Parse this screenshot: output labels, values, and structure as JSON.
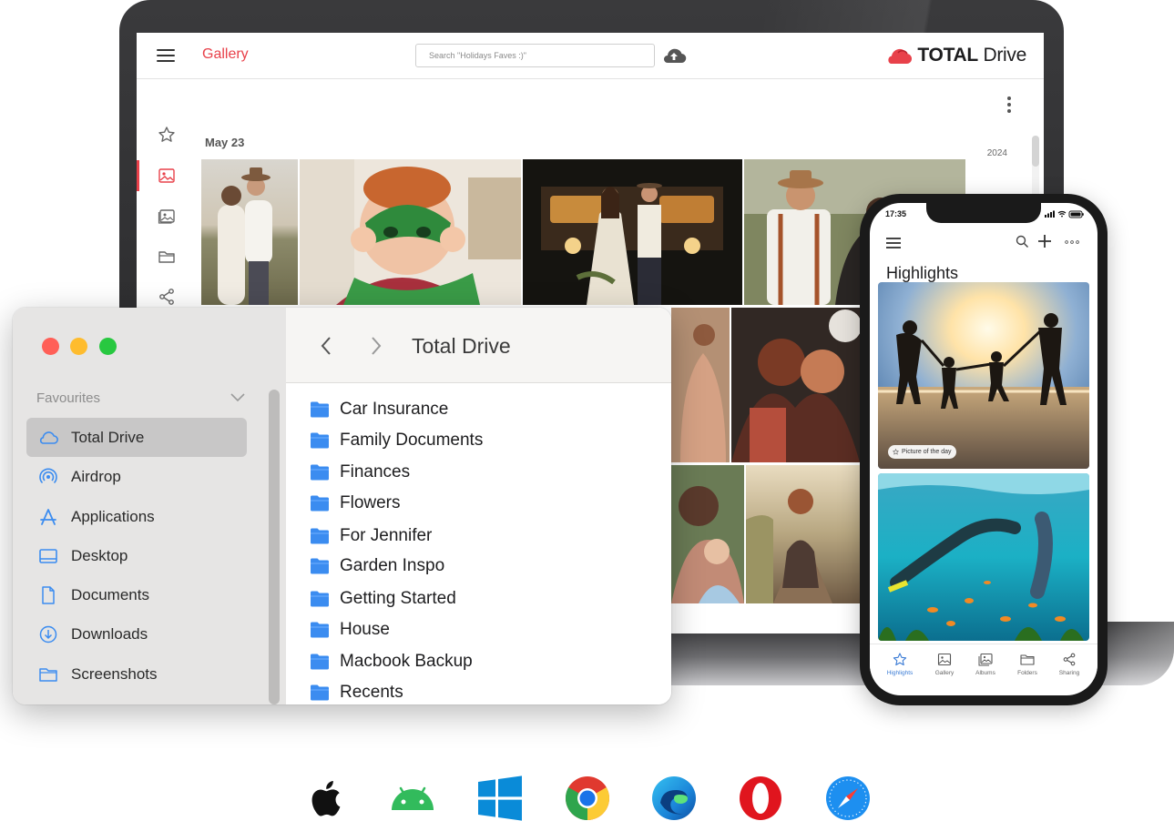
{
  "web_app": {
    "title": "Gallery",
    "search_placeholder": "Search \"Holidays Faves :)\"",
    "brand_bold": "TOTAL",
    "brand_light": "Drive",
    "date_group": "May 23",
    "year": "2024",
    "sidebar_icons": [
      "star-icon",
      "image-icon",
      "album-icon",
      "folder-icon",
      "share-icon"
    ],
    "accent_color": "#e8414a"
  },
  "finder": {
    "title": "Total Drive",
    "section_label": "Favourites",
    "sidebar_items": [
      {
        "label": "Total Drive",
        "icon": "cloud-icon",
        "selected": true
      },
      {
        "label": "Airdrop",
        "icon": "airdrop-icon",
        "selected": false
      },
      {
        "label": "Applications",
        "icon": "applications-icon",
        "selected": false
      },
      {
        "label": "Desktop",
        "icon": "desktop-icon",
        "selected": false
      },
      {
        "label": "Documents",
        "icon": "document-icon",
        "selected": false
      },
      {
        "label": "Downloads",
        "icon": "download-icon",
        "selected": false
      },
      {
        "label": "Screenshots",
        "icon": "folder-icon",
        "selected": false
      }
    ],
    "folders": [
      "Car Insurance",
      "Family Documents",
      "Finances",
      "Flowers",
      "For Jennifer",
      "Garden Inspo",
      "Getting Started",
      "House",
      "Macbook Backup",
      "Recents"
    ],
    "folder_color": "#3b8cf0",
    "traffic_colors": [
      "#ff5f57",
      "#febc2e",
      "#28c840"
    ]
  },
  "phone": {
    "time": "17:35",
    "heading": "Highlights",
    "badge": "Picture of the day",
    "tabs": [
      {
        "label": "Highlights",
        "icon": "star-icon",
        "active": true
      },
      {
        "label": "Gallery",
        "icon": "image-icon",
        "active": false
      },
      {
        "label": "Albums",
        "icon": "album-icon",
        "active": false
      },
      {
        "label": "Folders",
        "icon": "folder-icon",
        "active": false
      },
      {
        "label": "Sharing",
        "icon": "share-icon",
        "active": false
      }
    ],
    "active_color": "#3a7bd5"
  },
  "platforms": [
    "apple-icon",
    "android-icon",
    "windows-icon",
    "chrome-icon",
    "edge-icon",
    "opera-icon",
    "safari-icon"
  ]
}
